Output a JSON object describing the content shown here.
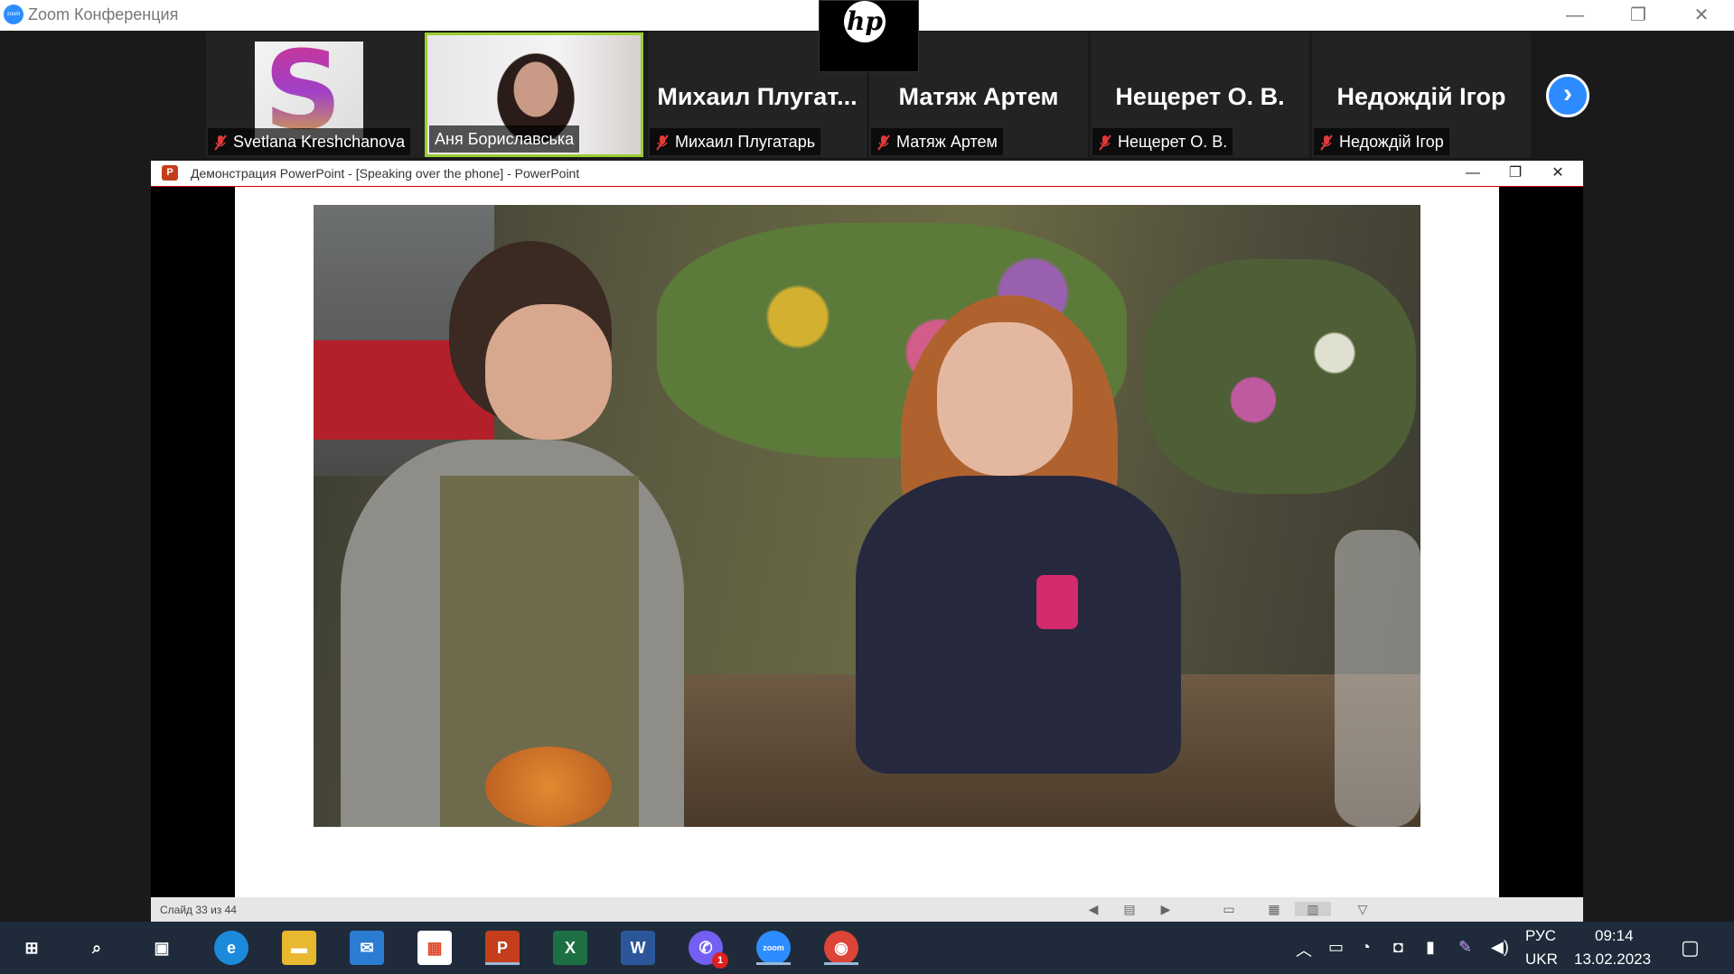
{
  "zoom": {
    "title": "Zoom Конференция",
    "logo_text": "zoom",
    "hp_logo": "hp",
    "controls": {
      "minimize": "—",
      "restore": "❐",
      "close": "✕"
    }
  },
  "participants": [
    {
      "footer": "Svetlana Kreshchanova",
      "big_name": "",
      "type": "avatar",
      "avatar_letter": "S"
    },
    {
      "footer": "Аня Бориславська",
      "big_name": "",
      "type": "video"
    },
    {
      "footer": "Михаил Плугатарь",
      "big_name": "Михаил  Плугат...",
      "type": "name"
    },
    {
      "footer": "Матяж Артем",
      "big_name": "Матяж Артем",
      "type": "name"
    },
    {
      "footer": "Нещерет О. В.",
      "big_name": "Нещерет О. В.",
      "type": "name"
    },
    {
      "footer": "Недождій Ігор",
      "big_name": "Недождій Ігор",
      "type": "name"
    }
  ],
  "next_button": "›",
  "powerpoint": {
    "icon": "P",
    "title": "Демонстрация PowerPoint - [Speaking over the phone] - PowerPoint",
    "controls": {
      "minimize": "—",
      "restore": "❐",
      "close": "✕"
    },
    "status": {
      "slide_count": "Слайд 33 из 44"
    }
  },
  "taskbar": {
    "lang_primary": "РУС",
    "lang_secondary": "UKR",
    "time": "09:14",
    "date": "13.02.2023",
    "apps": [
      {
        "name": "windows-start-icon",
        "label": "⊞",
        "bg": "transparent"
      },
      {
        "name": "search-icon",
        "label": "⌕",
        "bg": "transparent"
      },
      {
        "name": "task-view-icon",
        "label": "▣",
        "bg": "transparent"
      },
      {
        "name": "edge-icon",
        "label": "e",
        "bg": "#1c8adb"
      },
      {
        "name": "file-explorer-icon",
        "label": "▬",
        "bg": "#e8b830"
      },
      {
        "name": "mail-icon",
        "label": "✉",
        "bg": "#2b7cd3"
      },
      {
        "name": "store-icon",
        "label": "▦",
        "bg": "#ffffff"
      },
      {
        "name": "powerpoint-icon",
        "label": "P",
        "bg": "#c43e1c"
      },
      {
        "name": "excel-icon",
        "label": "X",
        "bg": "#1d7044"
      },
      {
        "name": "word-icon",
        "label": "W",
        "bg": "#2b579a"
      },
      {
        "name": "viber-icon",
        "label": "✆",
        "bg": "#7360f2",
        "badge": "1"
      },
      {
        "name": "zoom-icon",
        "label": "zoom",
        "bg": "#2d8cff"
      },
      {
        "name": "chrome-icon",
        "label": "◉",
        "bg": "#db4437"
      }
    ]
  }
}
